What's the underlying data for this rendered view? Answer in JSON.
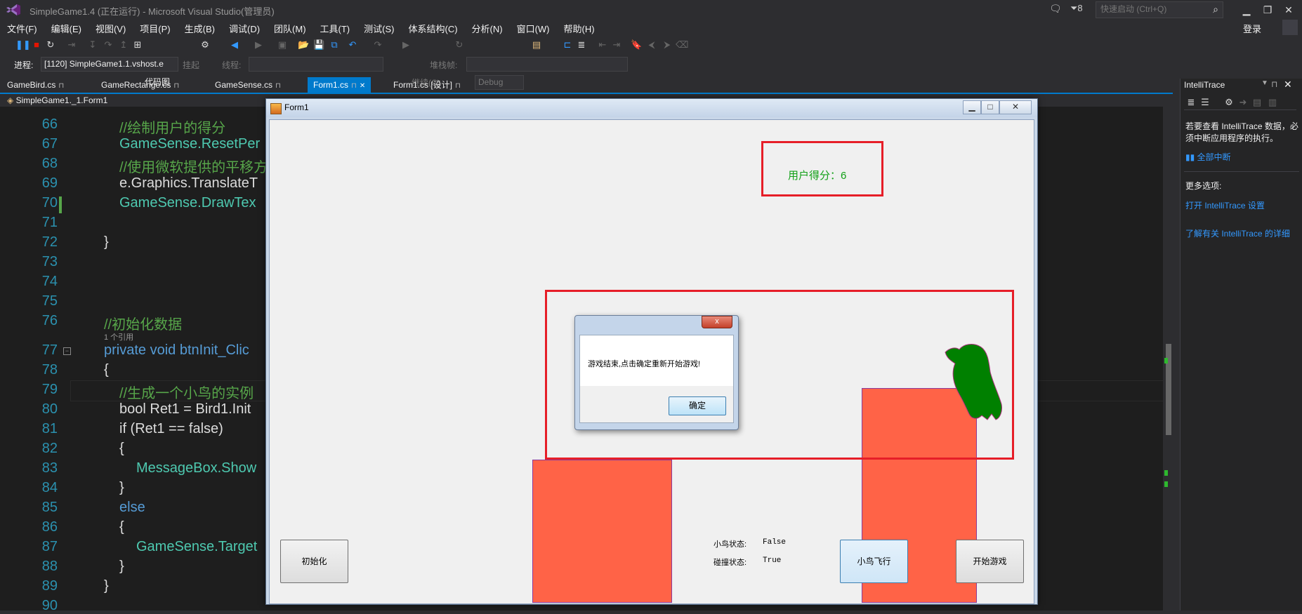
{
  "window": {
    "title": "SimpleGame1.4 (正在运行) - Microsoft Visual Studio(管理员)",
    "notification_count": "8",
    "quick_launch_placeholder": "快速启动 (Ctrl+Q)",
    "minimize": "▁",
    "restore": "❐",
    "close": "✕"
  },
  "menu": {
    "items": [
      "文件(F)",
      "编辑(E)",
      "视图(V)",
      "项目(P)",
      "生成(B)",
      "调试(D)",
      "团队(M)",
      "工具(T)",
      "测试(S)",
      "体系结构(C)",
      "分析(N)",
      "窗口(W)",
      "帮助(H)"
    ],
    "login": "登录"
  },
  "toolbar": {
    "code_map": "代码图",
    "continue": "继续(C)",
    "configuration": "Debug",
    "process_label": "进程:",
    "process_value": "[1120] SimpleGame1.1.vshost.e",
    "suspend_label": "挂起",
    "thread_label": "线程:",
    "stack_label": "堆栈帧:"
  },
  "tabs": [
    {
      "label": "GameBird.cs",
      "active": false
    },
    {
      "label": "GameRectange.cs",
      "active": false
    },
    {
      "label": "GameSense.cs",
      "active": false
    },
    {
      "label": "Form1.cs",
      "active": true
    },
    {
      "label": "Form1.cs [设计]",
      "active": false
    }
  ],
  "navigation": {
    "class": "SimpleGame1._1.Form1"
  },
  "code_lines": [
    {
      "n": "66",
      "text": "//绘制用户的得分"
    },
    {
      "n": "67",
      "text": "GameSense.ResetPer"
    },
    {
      "n": "68",
      "text": "//使用微软提供的平移方"
    },
    {
      "n": "69",
      "text": "e.Graphics.TranslateT"
    },
    {
      "n": "70",
      "text": "GameSense.DrawTex"
    },
    {
      "n": "71",
      "text": ""
    },
    {
      "n": "72",
      "text": "}"
    },
    {
      "n": "73",
      "text": ""
    },
    {
      "n": "74",
      "text": ""
    },
    {
      "n": "75",
      "text": ""
    },
    {
      "n": "76",
      "text": "//初始化数据"
    },
    {
      "n": "77",
      "text": "private void btnInit_Clic"
    },
    {
      "n": "78",
      "text": "{"
    },
    {
      "n": "79",
      "text": "//生成一个小鸟的实例"
    },
    {
      "n": "80",
      "text": "bool Ret1 = Bird1.Init"
    },
    {
      "n": "81",
      "text": "if (Ret1 == false)"
    },
    {
      "n": "82",
      "text": "{"
    },
    {
      "n": "83",
      "text": "MessageBox.Show"
    },
    {
      "n": "84",
      "text": "}"
    },
    {
      "n": "85",
      "text": "else"
    },
    {
      "n": "86",
      "text": "{"
    },
    {
      "n": "87",
      "text": "GameSense.Target"
    },
    {
      "n": "88",
      "text": "}"
    },
    {
      "n": "89",
      "text": "}"
    },
    {
      "n": "90",
      "text": ""
    }
  ],
  "code_lens": "1 个引用",
  "intellitrace": {
    "title": "IntelliTrace",
    "description": "若要查看 IntelliTrace 数据，必须中断应用程序的执行。",
    "break_all": "全部中断",
    "more_options": "更多选项:",
    "open_settings": "打开 IntelliTrace 设置",
    "learn_more": "了解有关 IntelliTrace 的详细"
  },
  "form": {
    "title": "Form1",
    "score_text": "用户得分：6",
    "message_box": {
      "text": "游戏结束,点击确定重新开始游戏!",
      "ok_button": "确定",
      "close": "x"
    },
    "buttons": {
      "init": "初始化",
      "fly": "小鸟飞行",
      "start": "开始游戏"
    },
    "bird_status_label": "小鸟状态:",
    "bird_status_value": "False",
    "collision_label": "碰撞状态:",
    "collision_value": "True"
  },
  "colors": {
    "ide_background": "#2d2d30",
    "editor_background": "#1e1e1e",
    "accent": "#007acc",
    "comment": "#57a64a",
    "keyword": "#569cd6",
    "type": "#4ec9b0",
    "pipe": "#ff6347",
    "bird": "#008000",
    "score_text": "#11a016",
    "highlight_border": "#e61e28"
  }
}
